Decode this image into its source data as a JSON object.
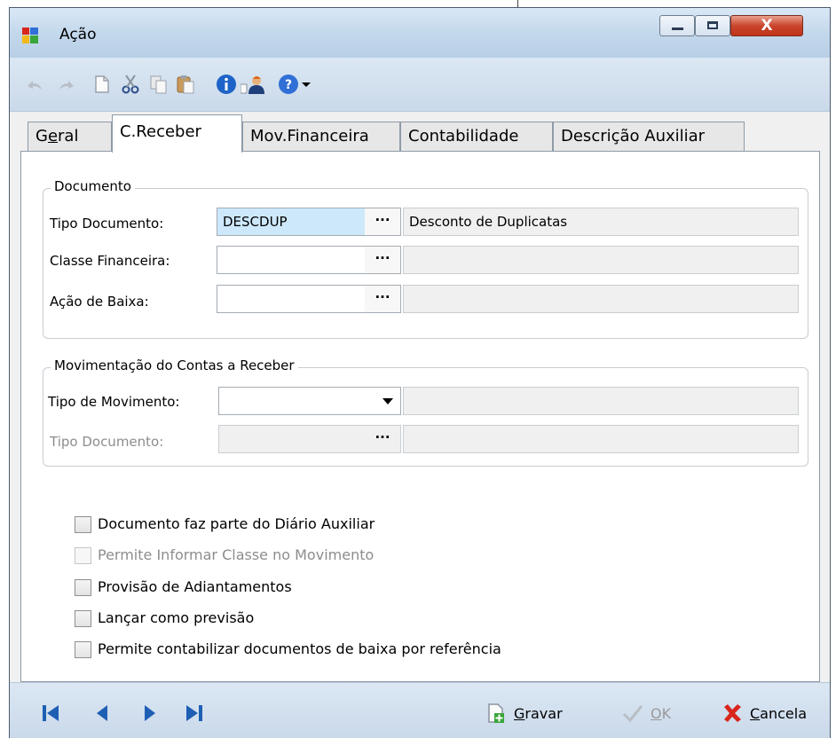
{
  "window": {
    "title": "Ação",
    "close_label": "X"
  },
  "toolbar": {
    "icons": [
      "undo-icon",
      "redo-icon",
      "new-icon",
      "cut-icon",
      "copy-icon",
      "paste-icon",
      "info-icon",
      "user-attach-icon",
      "help-icon",
      "dropdown-arrow-icon"
    ]
  },
  "tabs": [
    {
      "label_pre": "G",
      "label_u": "e",
      "label_post": "ral"
    },
    {
      "label": "C.Receber"
    },
    {
      "label": "Mov.Financeira"
    },
    {
      "label": "Contabilidade"
    },
    {
      "label": "Descrição Auxiliar"
    }
  ],
  "documento": {
    "title": "Documento",
    "tipo_documento": {
      "label": "Tipo Documento:",
      "value": "DESCDUP",
      "description": "Desconto de Duplicatas",
      "button": "···"
    },
    "classe_financeira": {
      "label": "Classe Financeira:",
      "value": "",
      "description": "",
      "button": "···"
    },
    "acao_baixa": {
      "label": "Ação de Baixa:",
      "value": "",
      "description": "",
      "button": "···"
    }
  },
  "movimentacao": {
    "title": "Movimentação do Contas a Receber",
    "tipo_movimento": {
      "label": "Tipo de Movimento:",
      "value": "",
      "description": ""
    },
    "tipo_documento": {
      "label": "Tipo Documento:",
      "value": "",
      "description": "",
      "button": "···"
    }
  },
  "checkboxes": [
    {
      "label": "Documento faz parte do Diário Auxiliar",
      "checked": false,
      "enabled": true
    },
    {
      "label": "Permite Informar Classe no Movimento",
      "checked": false,
      "enabled": false
    },
    {
      "label": "Provisão de Adiantamentos",
      "checked": false,
      "enabled": true
    },
    {
      "label": "Lançar como previsão",
      "checked": false,
      "enabled": true
    },
    {
      "label": "Permite contabilizar documentos de baixa por referência",
      "checked": false,
      "enabled": true
    }
  ],
  "bottom": {
    "gravar": {
      "u": "G",
      "rest": "ravar"
    },
    "ok": {
      "u": "O",
      "rest": "K"
    },
    "cancela": {
      "u": "C",
      "rest": "ancela"
    }
  },
  "colors": {
    "accent": "#1e5fb4",
    "cancel": "#d9261c",
    "selection": "#cde8fb"
  }
}
